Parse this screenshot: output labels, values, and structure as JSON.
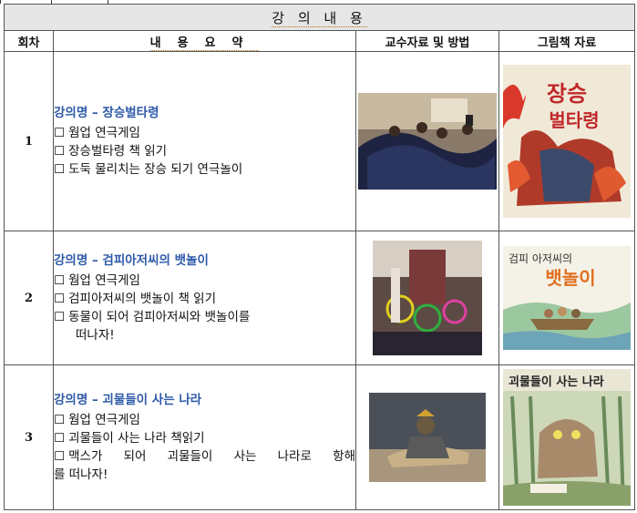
{
  "header": {
    "title": "강 의 내 용",
    "col_round": "회차",
    "col_summary": "내용요약",
    "col_materials": "교수자료 및 방법",
    "col_picturebook": "그림책 자료"
  },
  "rows": [
    {
      "round": "1",
      "lecture_title": "강의명 – 장승벌타령",
      "items": [
        "웜업 연극게임",
        "장승벌타령 책 읽기",
        "도둑 물리치는 장승 되기 연극놀이"
      ],
      "book_title_art": "장승 벌타령"
    },
    {
      "round": "2",
      "lecture_title": "강의명 – 검피아저씨의 뱃놀이",
      "items": [
        "웜업 연극게임",
        "검피아저씨의 뱃놀이 책 읽기",
        "동물이 되어 검피아저씨와 뱃놀이를",
        "떠나자!"
      ],
      "book_title_art": "검피 아저씨의 뱃놀이"
    },
    {
      "round": "3",
      "lecture_title": "강의명 – 괴물들이 사는 나라",
      "items": [
        "웜업 연극게임",
        "괴물들이 사는 나라 책읽기",
        "맥스가 되어 괴물들이 사는 나라로 항해",
        "를 떠나자!"
      ],
      "book_title_art": "괴물들이 사는 나라"
    }
  ],
  "checkbox_glyph": "☐"
}
